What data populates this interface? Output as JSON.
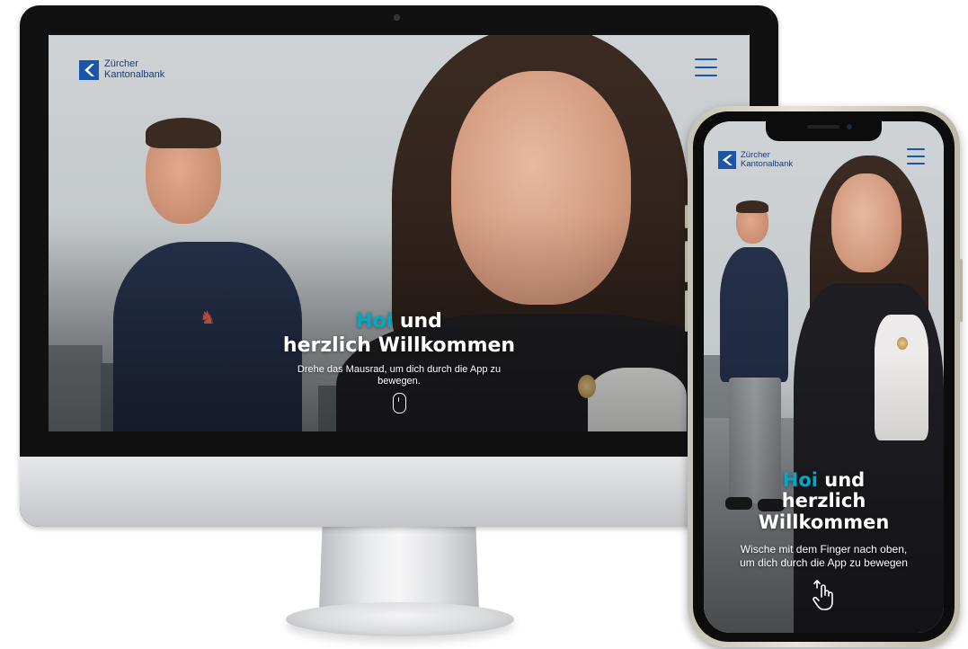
{
  "brand": {
    "name_line1": "Zürcher",
    "name_line2": "Kantonalbank",
    "primary_color": "#1a56a7",
    "accent_color": "#00a9c5"
  },
  "desktop": {
    "greeting_highlight": "Hoi",
    "greeting_rest": " und",
    "greeting_line2": "herzlich Willkommen",
    "hint_line1": "Drehe das Mausrad, um dich durch die App zu",
    "hint_line2": "bewegen.",
    "menu_icon": "hamburger-menu-icon",
    "scroll_icon": "mouse-icon"
  },
  "mobile": {
    "greeting_highlight": "Hoi",
    "greeting_rest": " und",
    "greeting_line2": "herzlich",
    "greeting_line3": "Willkommen",
    "hint_line1": "Wische mit dem Finger nach oben,",
    "hint_line2": "um dich durch die App zu bewegen",
    "menu_icon": "hamburger-menu-icon",
    "swipe_icon": "swipe-up-hand-icon"
  }
}
